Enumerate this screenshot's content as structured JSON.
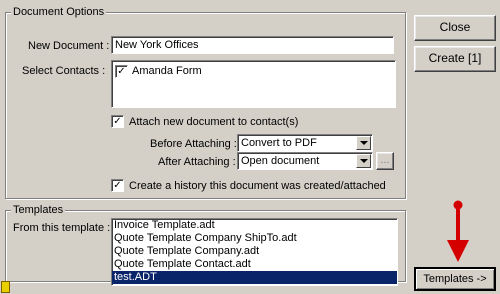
{
  "document_options": {
    "title": "Document Options",
    "new_document_label": "New Document :",
    "new_document_value": "New York Offices",
    "select_contacts_label": "Select Contacts :",
    "contacts": [
      {
        "name": "Amanda Form",
        "checked": true
      }
    ],
    "attach_label": "Attach new document to contact(s)",
    "attach_checked": true,
    "before_attaching_label": "Before Attaching :",
    "before_attaching_value": "Convert to PDF",
    "after_attaching_label": "After Attaching :",
    "after_attaching_value": "Open document",
    "browse_label": "...",
    "history_label": "Create a history this document was created/attached",
    "history_checked": true
  },
  "buttons": {
    "close": "Close",
    "create": "Create [1]",
    "templates": "Templates ->"
  },
  "templates": {
    "title": "Templates",
    "from_label": "From this template :",
    "items": [
      {
        "name": "Invoice Template.adt",
        "selected": false
      },
      {
        "name": "Quote Template Company ShipTo.adt",
        "selected": false
      },
      {
        "name": "Quote Template Company.adt",
        "selected": false
      },
      {
        "name": "Quote Template Contact.adt",
        "selected": false
      },
      {
        "name": "test.ADT",
        "selected": true
      }
    ]
  },
  "annotation": {
    "arrow_color": "#d40000",
    "arrow_icon": "red-down-arrow-icon"
  }
}
